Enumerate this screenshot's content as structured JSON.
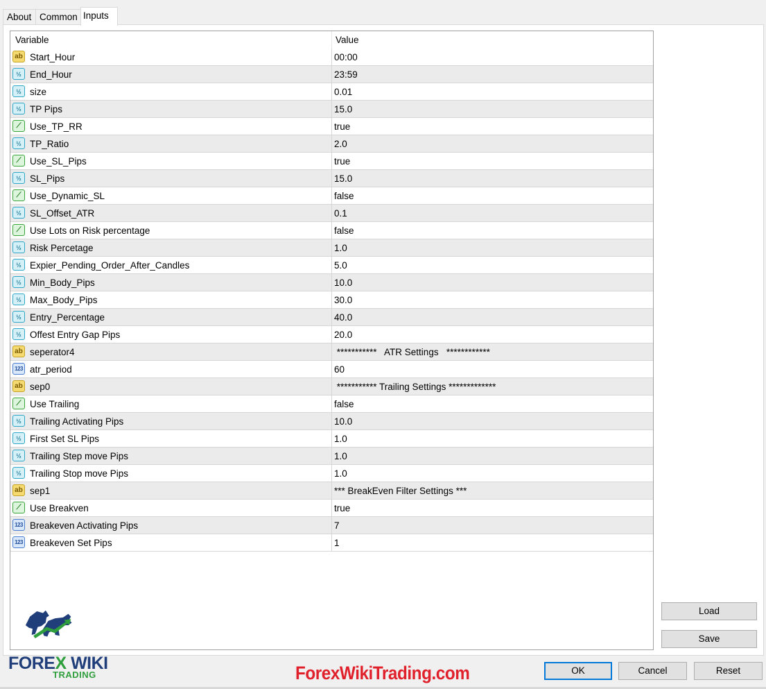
{
  "tabs": [
    {
      "label": "About"
    },
    {
      "label": "Common"
    },
    {
      "label": "Inputs"
    }
  ],
  "grid": {
    "col_variable": "Variable",
    "col_value": "Value",
    "rows": [
      {
        "icon": "ab",
        "name": "Start_Hour",
        "value": "00:00"
      },
      {
        "icon": "half",
        "name": "End_Hour",
        "value": "23:59"
      },
      {
        "icon": "half",
        "name": "size",
        "value": "0.01"
      },
      {
        "icon": "half",
        "name": "TP Pips",
        "value": "15.0"
      },
      {
        "icon": "bool",
        "name": "Use_TP_RR",
        "value": "true"
      },
      {
        "icon": "half",
        "name": "TP_Ratio",
        "value": "2.0"
      },
      {
        "icon": "bool",
        "name": "Use_SL_Pips",
        "value": "true"
      },
      {
        "icon": "half",
        "name": "SL_Pips",
        "value": "15.0"
      },
      {
        "icon": "bool",
        "name": "Use_Dynamic_SL",
        "value": "false"
      },
      {
        "icon": "half",
        "name": "SL_Offset_ATR",
        "value": "0.1"
      },
      {
        "icon": "bool",
        "name": "Use Lots on Risk percentage",
        "value": "false"
      },
      {
        "icon": "half",
        "name": "Risk Percetage",
        "value": "1.0"
      },
      {
        "icon": "half",
        "name": "Expier_Pending_Order_After_Candles",
        "value": "5.0"
      },
      {
        "icon": "half",
        "name": "Min_Body_Pips",
        "value": "10.0"
      },
      {
        "icon": "half",
        "name": "Max_Body_Pips",
        "value": "30.0"
      },
      {
        "icon": "half",
        "name": "Entry_Percentage",
        "value": "40.0"
      },
      {
        "icon": "half",
        "name": "Offest Entry Gap Pips",
        "value": "20.0"
      },
      {
        "icon": "ab",
        "name": "seperator4",
        "value": " ***********   ATR Settings   ************"
      },
      {
        "icon": "num",
        "name": "atr_period",
        "value": "60"
      },
      {
        "icon": "ab",
        "name": "sep0",
        "value": " *********** Trailing Settings *************"
      },
      {
        "icon": "bool",
        "name": "Use Trailing",
        "value": "false"
      },
      {
        "icon": "half",
        "name": "Trailing Activating Pips",
        "value": "10.0"
      },
      {
        "icon": "half",
        "name": "First Set SL  Pips",
        "value": "1.0"
      },
      {
        "icon": "half",
        "name": "Trailing Step move Pips",
        "value": "1.0"
      },
      {
        "icon": "half",
        "name": "Trailing Stop move Pips",
        "value": "1.0"
      },
      {
        "icon": "ab",
        "name": "sep1",
        "value": "*** BreakEven Filter Settings ***"
      },
      {
        "icon": "bool",
        "name": "Use Breakven",
        "value": "true"
      },
      {
        "icon": "num",
        "name": "Breakeven Activating Pips",
        "value": "7"
      },
      {
        "icon": "num",
        "name": "Breakeven Set Pips",
        "value": "1"
      }
    ]
  },
  "icons": {
    "ab": "ab",
    "half": "½",
    "bool": "⟋",
    "num": "123"
  },
  "buttons": {
    "load": "Load",
    "save": "Save",
    "ok": "OK",
    "cancel": "Cancel",
    "reset": "Reset"
  },
  "branding": {
    "site": "ForexWikiTrading.com",
    "logo_forex": "FORE",
    "logo_x": "X",
    "logo_wiki": " WIKI",
    "logo_trading": "TRADING"
  }
}
